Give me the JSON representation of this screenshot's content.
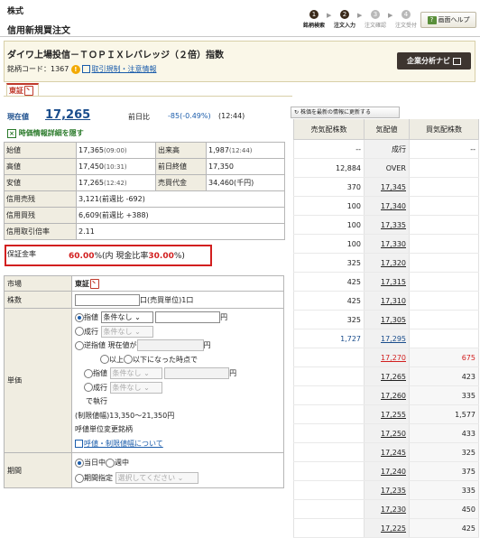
{
  "header": {
    "category": "株式",
    "title": "信用新規買注文",
    "steps": [
      {
        "num": "1",
        "label": "銘柄検索",
        "state": "on"
      },
      {
        "num": "2",
        "label": "注文入力",
        "state": "on"
      },
      {
        "num": "3",
        "label": "注文確認",
        "state": "off"
      },
      {
        "num": "4",
        "label": "注文受付",
        "state": "off"
      }
    ],
    "help_label": "画面ヘルプ"
  },
  "stock": {
    "name": "ダイワ上場投信－ＴＯＰＩＸレバレッジ（２倍）指数",
    "code_label": "銘柄コード：1367",
    "reg_link": "取引規制・注意情報",
    "nav_button": "企業分析ナビ",
    "market_tab": "東証"
  },
  "price": {
    "current_label": "現在値",
    "current_value": "17,265",
    "prev_label": "前日比",
    "prev_value": "-85(-0.49%)",
    "prev_time": "(12:44)",
    "hide_link": "時価情報詳細を隠す"
  },
  "quote": [
    [
      {
        "k": "始値"
      },
      {
        "v": "17,365",
        "t": "(09:00)"
      },
      {
        "k": "出来高"
      },
      {
        "v": "1,987",
        "t": "(12:44)"
      }
    ],
    [
      {
        "k": "高値"
      },
      {
        "v": "17,450",
        "t": "(10:31)"
      },
      {
        "k": "前日終値"
      },
      {
        "v": "17,350"
      }
    ],
    [
      {
        "k": "安値"
      },
      {
        "v": "17,265",
        "t": "(12:42)"
      },
      {
        "k": "売買代金"
      },
      {
        "v": "34,460(千円)"
      }
    ]
  ],
  "credit": [
    {
      "k": "信用売残",
      "v": "3,121(前週比 -692)"
    },
    {
      "k": "信用買残",
      "v": "6,609(前週比 +388)"
    },
    {
      "k": "信用取引倍率",
      "v": "2.11"
    }
  ],
  "margin": {
    "label": "保証金率",
    "rate": "60.00",
    "pct_open": "%(内 現金比率",
    "cash": "30.00",
    "pct_close": "%)"
  },
  "order": {
    "market_label": "市場",
    "market_value": "東証",
    "qty_label": "株数",
    "qty_suffix": "口(売買単位)1口",
    "price_label": "単価",
    "limit_label": "指値",
    "cond_none": "条件なし",
    "yen": "円",
    "market_order": "成行",
    "stop_label": "逆指値",
    "stop_text": "現在値が",
    "above": "以上",
    "below": "以下になった時点で",
    "exec": "で執行",
    "range": "(制限値幅)13,350～21,350円",
    "tick_note": "呼値単位変更銘柄",
    "tick_link": "呼値・制限値幅について",
    "period_label": "期間",
    "today": "当日中",
    "week": "週中",
    "period_specify": "期間指定",
    "period_ph": "選択してください"
  },
  "board": {
    "refresh": "株価を最新の情報に更新する",
    "headers": [
      "売気配株数",
      "気配値",
      "買気配株数"
    ],
    "rows": [
      {
        "sell": "--",
        "price": "成行",
        "buy": "--"
      },
      {
        "sell": "12,884",
        "price": "OVER",
        "buy": ""
      },
      {
        "sell": "370",
        "price": "17,345",
        "buy": ""
      },
      {
        "sell": "100",
        "price": "17,340",
        "buy": ""
      },
      {
        "sell": "100",
        "price": "17,335",
        "buy": ""
      },
      {
        "sell": "100",
        "price": "17,330",
        "buy": ""
      },
      {
        "sell": "325",
        "price": "17,320",
        "buy": ""
      },
      {
        "sell": "425",
        "price": "17,315",
        "buy": ""
      },
      {
        "sell": "425",
        "price": "17,310",
        "buy": ""
      },
      {
        "sell": "325",
        "price": "17,305",
        "buy": ""
      },
      {
        "sell": "1,727",
        "price": "17,295",
        "buy": ""
      },
      {
        "sell": "",
        "price": "17,270",
        "buy": "675"
      },
      {
        "sell": "",
        "price": "17,265",
        "buy": "423"
      },
      {
        "sell": "",
        "price": "17,260",
        "buy": "335"
      },
      {
        "sell": "",
        "price": "17,255",
        "buy": "1,577"
      },
      {
        "sell": "",
        "price": "17,250",
        "buy": "433"
      },
      {
        "sell": "",
        "price": "17,245",
        "buy": "325"
      },
      {
        "sell": "",
        "price": "17,240",
        "buy": "375"
      },
      {
        "sell": "",
        "price": "17,235",
        "buy": "335"
      },
      {
        "sell": "",
        "price": "17,230",
        "buy": "450"
      },
      {
        "sell": "",
        "price": "17,225",
        "buy": "425"
      }
    ]
  }
}
